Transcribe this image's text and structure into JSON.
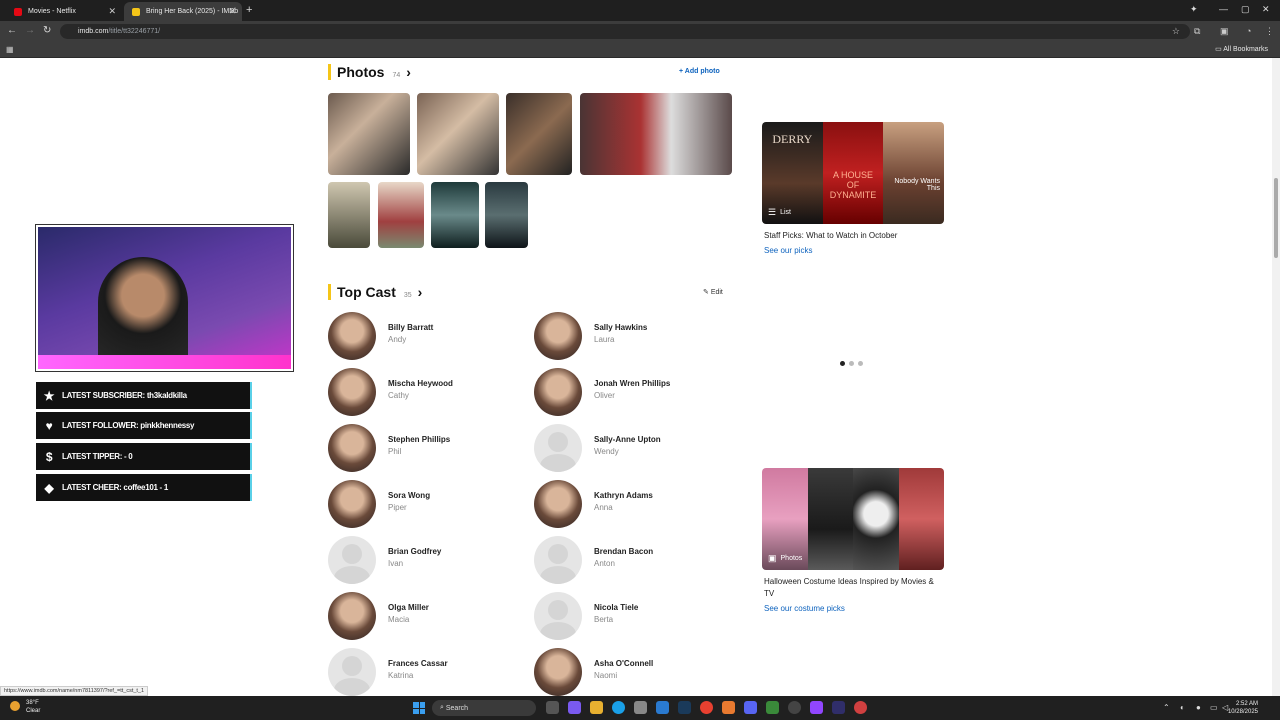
{
  "browser": {
    "tabs": [
      {
        "label": "Movies - Netflix",
        "fav_color": "#e50914"
      },
      {
        "label": "Bring Her Back (2025) - IMDb",
        "fav_color": "#f5c518"
      }
    ],
    "url_host": "imdb.com",
    "url_path": "/title/tt32246771/",
    "bookmarks_label": "All Bookmarks"
  },
  "photos": {
    "title": "Photos",
    "count": "74",
    "add_label": "Add photo"
  },
  "top_cast": {
    "title": "Top Cast",
    "count": "35",
    "edit_label": "Edit",
    "left": [
      {
        "name": "Billy Barratt",
        "role": "Andy",
        "photo": true
      },
      {
        "name": "Mischa Heywood",
        "role": "Cathy",
        "photo": true
      },
      {
        "name": "Stephen Phillips",
        "role": "Phil",
        "photo": true
      },
      {
        "name": "Sora Wong",
        "role": "Piper",
        "photo": true
      },
      {
        "name": "Brian Godfrey",
        "role": "Ivan",
        "photo": false
      },
      {
        "name": "Olga Miller",
        "role": "Macia",
        "photo": true
      },
      {
        "name": "Frances Cassar",
        "role": "Katrina",
        "photo": false
      }
    ],
    "right": [
      {
        "name": "Sally Hawkins",
        "role": "Laura",
        "photo": true
      },
      {
        "name": "Jonah Wren Phillips",
        "role": "Oliver",
        "photo": true
      },
      {
        "name": "Sally-Anne Upton",
        "role": "Wendy",
        "photo": false
      },
      {
        "name": "Kathryn Adams",
        "role": "Anna",
        "photo": true
      },
      {
        "name": "Brendan Bacon",
        "role": "Anton",
        "photo": false
      },
      {
        "name": "Nicola Tiele",
        "role": "Berta",
        "photo": false
      },
      {
        "name": "Asha O'Connell",
        "role": "Naomi",
        "photo": true
      }
    ]
  },
  "sidebar": {
    "promo1": {
      "tag": "List",
      "caption": "Staff Picks: What to Watch in October",
      "link": "See our picks",
      "poster1": "DERRY",
      "poster2": "A HOUSE OF DYNAMITE",
      "poster3": "Nobody Wants This"
    },
    "promo2": {
      "tag": "Photos",
      "caption": "Halloween Costume Ideas Inspired by Movies & TV",
      "link": "See our costume picks"
    },
    "carousel_active": 0,
    "carousel_count": 3
  },
  "overlay": {
    "widgets": [
      {
        "icon": "★",
        "text": "LATEST SUBSCRIBER: th3kaldkilla"
      },
      {
        "icon": "♥",
        "text": "LATEST FOLLOWER: pinkkhennessy"
      },
      {
        "icon": "$",
        "text": "LATEST TIPPER: - 0"
      },
      {
        "icon": "◆",
        "text": "LATEST CHEER: coffee101 - 1"
      }
    ]
  },
  "status_url": "https://www.imdb.com/name/nm7811397/?ref_=tt_cst_t_1",
  "taskbar": {
    "weather_temp": "38°F",
    "weather_desc": "Clear",
    "search_label": "Search",
    "time": "2:52 AM",
    "date": "10/28/2025"
  }
}
